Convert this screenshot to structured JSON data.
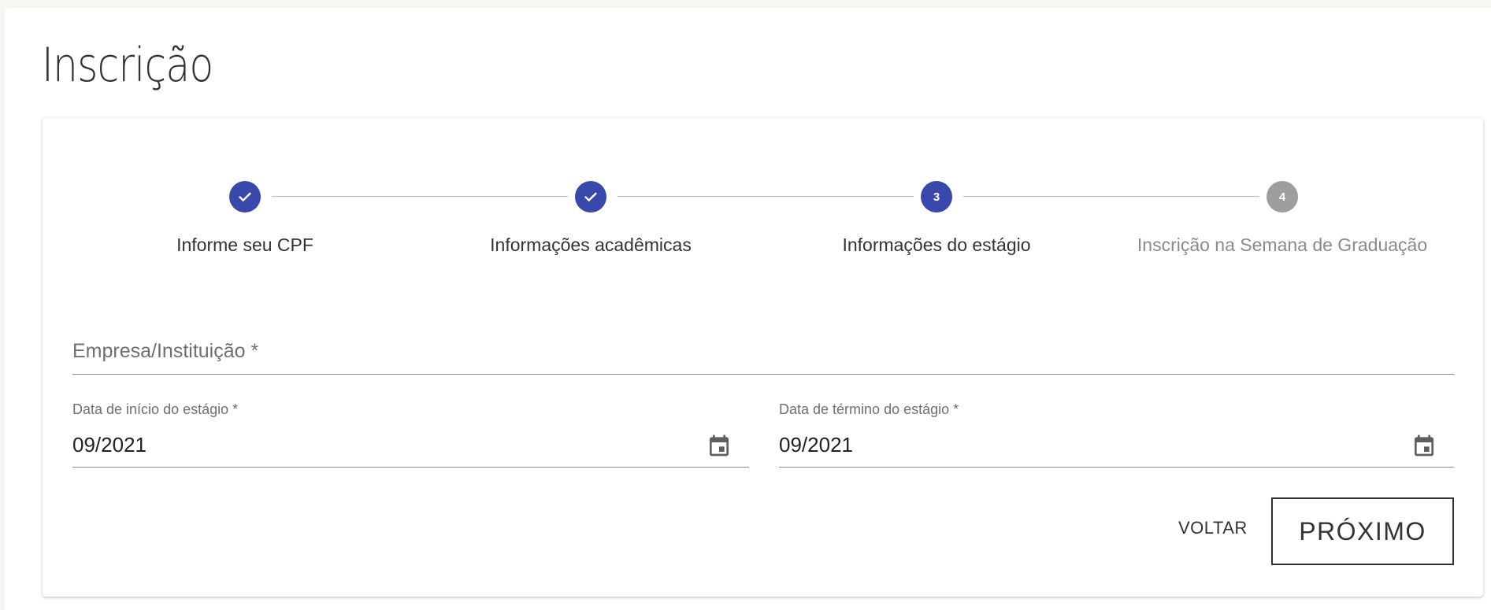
{
  "page": {
    "title": "Inscrição"
  },
  "stepper": {
    "steps": [
      {
        "label": "Informe seu CPF",
        "state": "done",
        "number": "1"
      },
      {
        "label": "Informações acadêmicas",
        "state": "done",
        "number": "2"
      },
      {
        "label": "Informações do estágio",
        "state": "active",
        "number": "3"
      },
      {
        "label": "Inscrição na Semana de Graduação",
        "state": "pending",
        "number": "4"
      }
    ],
    "colors": {
      "active": "#3949ab",
      "pending": "#9e9e9e"
    }
  },
  "form": {
    "empresa": {
      "placeholder": "Empresa/Instituição *",
      "value": ""
    },
    "data_inicio": {
      "label": "Data de início do estágio *",
      "value": "09/2021",
      "icon": "calendar-icon"
    },
    "data_termino": {
      "label": "Data de término do estágio *",
      "value": "09/2021",
      "icon": "calendar-icon"
    }
  },
  "actions": {
    "back_label": "VOLTAR",
    "next_label": "PRÓXIMO"
  }
}
